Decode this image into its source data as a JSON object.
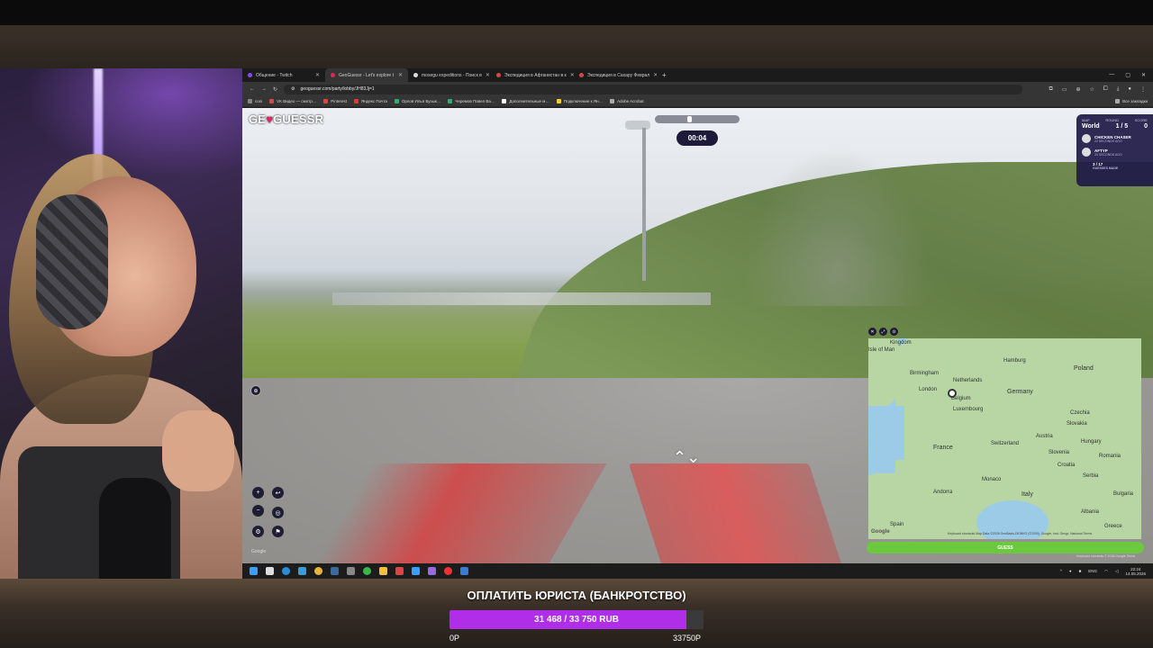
{
  "browser": {
    "tabs": [
      {
        "label": "Общение - Twitch",
        "active": false
      },
      {
        "label": "GeoGuessr - Let's explore t",
        "active": true
      },
      {
        "label": "mosegu expeditions - Поиск в",
        "active": false
      },
      {
        "label": "Экспедиция в Афганистан в к",
        "active": false
      },
      {
        "label": "Экспедиция в Сахару Феврал",
        "active": false
      }
    ],
    "new_tab": "+",
    "window_controls": [
      "—",
      "▢",
      "✕"
    ],
    "url": "geoguessr.com/party/lobby/JH83Jj=1",
    "bookmarks": [
      "cosi",
      "VK Видео — смотр…",
      "Pinterest",
      "Яндекс Почта",
      "Орлов Илья Бузык…",
      "Черемов Павел Ва…",
      "Дополнительные м…",
      "Подключение к Ян…",
      "Adobe Acrobat"
    ],
    "bookmarks_right": "Все закладки"
  },
  "game": {
    "logo_part1": "GE",
    "logo_pin": "♥",
    "logo_part2": "GUESSR",
    "timer": "00:04",
    "scoreboard": {
      "map_label": "MAP",
      "round_label": "ROUND",
      "score_label": "SCORE",
      "map_value": "World",
      "round_value": "1 / 5",
      "score_value": "0",
      "players": [
        {
          "name": "CHICKEN CHASER",
          "sub": "22 SECONDS AGO"
        },
        {
          "name": "AFTYP",
          "sub": "20 SECONDS AGO"
        }
      ],
      "guesses_count": "3 / 17",
      "guesses_label": "GUESSES MADE"
    },
    "guess_button": "GUESS",
    "map_labels": {
      "kingdom": "Kingdom",
      "isle_of_man": "Isle of Man",
      "birmingham": "Birmingham",
      "london": "London",
      "netherlands": "Netherlands",
      "hamburg": "Hamburg",
      "poland": "Poland",
      "belgium": "Belgium",
      "germany": "Germany",
      "luxembourg": "Luxembourg",
      "czechia": "Czechia",
      "slovakia": "Slovakia",
      "france": "France",
      "switzerland": "Switzerland",
      "austria": "Austria",
      "hungary": "Hungary",
      "slovenia": "Slovenia",
      "croatia": "Croatia",
      "romania": "Romania",
      "monaco": "Monaco",
      "serbia": "Serbia",
      "andorra": "Andorra",
      "italy": "Italy",
      "bulgaria": "Bulgaria",
      "spain": "Spain",
      "albania": "Albania",
      "greece": "Greece"
    },
    "map_google": "Google",
    "map_attribution": "Keyboard shortcuts   Map Data ©2026 GeoBasis-DE/BKG (©2009), Google, Inst. Geogr. Nacional  Terms",
    "corner_google": "Google",
    "kb_attribution": "Keyboard shortcuts  © 2026 Google  Terms"
  },
  "taskbar": {
    "lang": "ENG",
    "time": "22:24",
    "date": "14.05.2026"
  },
  "goal": {
    "title": "ОПЛАТИТЬ ЮРИСТА (БАНКРОТСТВО)",
    "progress_text": "31 468 / 33 750 RUB",
    "current": 31468,
    "target": 33750,
    "progress_fraction": 0.9324,
    "min_label": "0Р",
    "max_label": "33750Р",
    "fill_color": "#b12ee8"
  }
}
